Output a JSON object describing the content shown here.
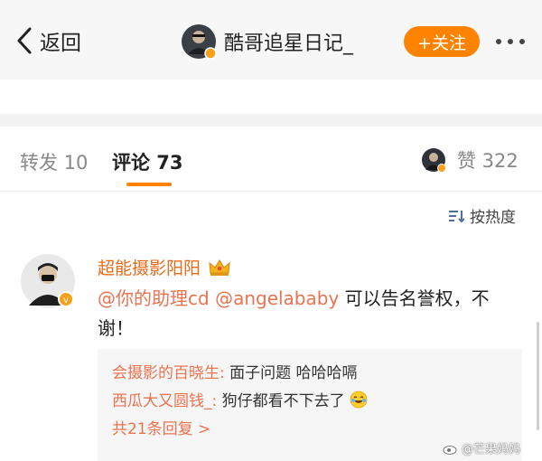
{
  "nav": {
    "back_label": "返回",
    "title": "酷哥追星日记_",
    "follow_label": "+关注",
    "more_icon": "more-dots-icon"
  },
  "tabs": {
    "forward": "转发 10",
    "comment": "评论 73",
    "like": "赞 322"
  },
  "sort": {
    "label": "按热度",
    "icon": "sort-icon"
  },
  "comment": {
    "username": "超能摄影阳阳",
    "badge_icon": "crown-icon",
    "mention1": "@你的助理cd",
    "mention2": "@angelababy",
    "text_tail": "可以告名誉权，不谢！"
  },
  "replies": [
    {
      "name": "会摄影的百晓生:",
      "text": " 面子问题 哈哈哈嗝"
    },
    {
      "name": "西瓜大又圆钱_:",
      "text": " 狗仔都看不下去了"
    }
  ],
  "replies_total": "共21条回复 >",
  "watermark": "@芒果妈妈",
  "colors": {
    "accent": "#ff8200",
    "link": "#eb7350",
    "username": "#e86b1a",
    "verified": "#f7a11a"
  }
}
